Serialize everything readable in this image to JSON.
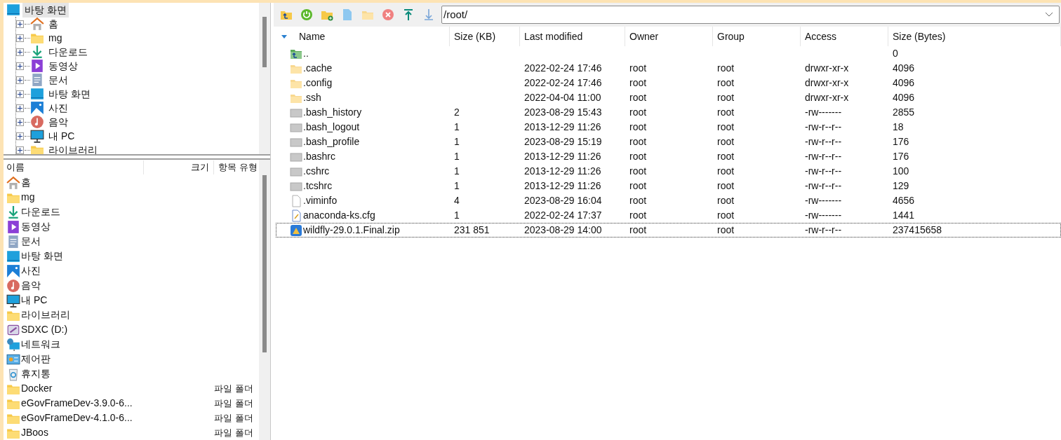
{
  "folder_tree": {
    "root": {
      "label": "바탕 화면",
      "kind": "desktop",
      "selected": true,
      "expanded": true
    },
    "children": [
      {
        "label": "홈",
        "kind": "home",
        "selected": false,
        "expanded": false
      },
      {
        "label": "mg",
        "kind": "folder",
        "selected": false,
        "expanded": false
      },
      {
        "label": "다운로드",
        "kind": "download",
        "selected": false,
        "expanded": false
      },
      {
        "label": "동영상",
        "kind": "video",
        "selected": false,
        "expanded": false
      },
      {
        "label": "문서",
        "kind": "document",
        "selected": false,
        "expanded": false
      },
      {
        "label": "바탕 화면",
        "kind": "desktop",
        "selected": false,
        "expanded": false
      },
      {
        "label": "사진",
        "kind": "picture",
        "selected": false,
        "expanded": false
      },
      {
        "label": "음악",
        "kind": "music",
        "selected": false,
        "expanded": false
      },
      {
        "label": "내 PC",
        "kind": "pc",
        "selected": false,
        "expanded": false
      },
      {
        "label": "라이브러리",
        "kind": "folder",
        "selected": false,
        "expanded": false
      }
    ]
  },
  "local_list": {
    "columns": [
      "이름",
      "크기",
      "항목 유형"
    ],
    "rows": [
      {
        "name": "홈",
        "kind": "home"
      },
      {
        "name": "mg",
        "kind": "folder"
      },
      {
        "name": "다운로드",
        "kind": "download"
      },
      {
        "name": "동영상",
        "kind": "video"
      },
      {
        "name": "문서",
        "kind": "document"
      },
      {
        "name": "바탕 화면",
        "kind": "desktop"
      },
      {
        "name": "사진",
        "kind": "picture"
      },
      {
        "name": "음악",
        "kind": "music"
      },
      {
        "name": "내 PC",
        "kind": "pc"
      },
      {
        "name": "라이브러리",
        "kind": "folder"
      },
      {
        "name": "SDXC (D:)",
        "kind": "sdcard"
      },
      {
        "name": "네트워크",
        "kind": "network"
      },
      {
        "name": "제어판",
        "kind": "control"
      },
      {
        "name": "휴지통",
        "kind": "recycle"
      },
      {
        "name": "Docker",
        "kind": "folder",
        "type": "파일 폴더"
      },
      {
        "name": "eGovFrameDev-3.9.0-6...",
        "kind": "folder",
        "type": "파일 폴더"
      },
      {
        "name": "eGovFrameDev-4.1.0-6...",
        "kind": "folder",
        "type": "파일 폴더"
      },
      {
        "name": "JBoos",
        "kind": "folder",
        "type": "파일 폴더"
      }
    ]
  },
  "remote": {
    "path": "/root/",
    "columns": [
      "Name",
      "Size (KB)",
      "Last modified",
      "Owner",
      "Group",
      "Access",
      "Size (Bytes)"
    ],
    "rows": [
      {
        "kind": "parent",
        "cells": [
          "..",
          "",
          "",
          "",
          "",
          "",
          "0"
        ],
        "selected": false
      },
      {
        "kind": "folder",
        "cells": [
          ".cache",
          "",
          "2022-02-24 17:46",
          "root",
          "root",
          "drwxr-xr-x",
          "4096"
        ],
        "selected": false
      },
      {
        "kind": "folder",
        "cells": [
          ".config",
          "",
          "2022-02-24 17:46",
          "root",
          "root",
          "drwxr-xr-x",
          "4096"
        ],
        "selected": false
      },
      {
        "kind": "folder",
        "cells": [
          ".ssh",
          "",
          "2022-04-04 11:00",
          "root",
          "root",
          "drwxr-xr-x",
          "4096"
        ],
        "selected": false
      },
      {
        "kind": "file",
        "cells": [
          ".bash_history",
          "2",
          "2023-08-29 15:43",
          "root",
          "root",
          "-rw-------",
          "2855"
        ],
        "selected": false
      },
      {
        "kind": "file",
        "cells": [
          ".bash_logout",
          "1",
          "2013-12-29 11:26",
          "root",
          "root",
          "-rw-r--r--",
          "18"
        ],
        "selected": false
      },
      {
        "kind": "file",
        "cells": [
          ".bash_profile",
          "1",
          "2023-08-29 15:19",
          "root",
          "root",
          "-rw-r--r--",
          "176"
        ],
        "selected": false
      },
      {
        "kind": "file",
        "cells": [
          ".bashrc",
          "1",
          "2013-12-29 11:26",
          "root",
          "root",
          "-rw-r--r--",
          "176"
        ],
        "selected": false
      },
      {
        "kind": "file",
        "cells": [
          ".cshrc",
          "1",
          "2013-12-29 11:26",
          "root",
          "root",
          "-rw-r--r--",
          "100"
        ],
        "selected": false
      },
      {
        "kind": "file",
        "cells": [
          ".tcshrc",
          "1",
          "2013-12-29 11:26",
          "root",
          "root",
          "-rw-r--r--",
          "129"
        ],
        "selected": false
      },
      {
        "kind": "text",
        "cells": [
          ".viminfo",
          "4",
          "2023-08-29 16:04",
          "root",
          "root",
          "-rw-------",
          "4656"
        ],
        "selected": false
      },
      {
        "kind": "config",
        "cells": [
          "anaconda-ks.cfg",
          "1",
          "2022-02-24 17:37",
          "root",
          "root",
          "-rw-------",
          "1441"
        ],
        "selected": false
      },
      {
        "kind": "zip",
        "cells": [
          "wildfly-29.0.1.Final.zip",
          "231 851",
          "2023-08-29 14:00",
          "root",
          "root",
          "-rw-r--r--",
          "237415658"
        ],
        "selected": true
      }
    ]
  }
}
